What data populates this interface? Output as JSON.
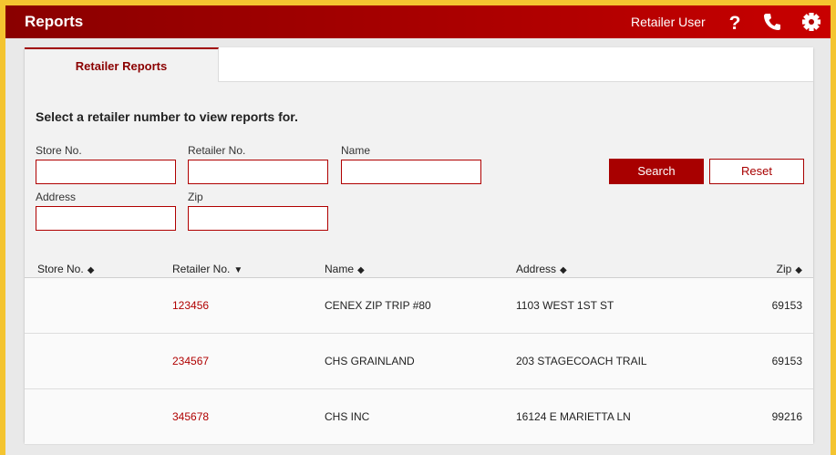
{
  "header": {
    "title": "Reports",
    "user_label": "Retailer User",
    "icons": [
      "help-icon",
      "phone-icon",
      "gear-icon"
    ],
    "color": "#a80000"
  },
  "tabs": [
    {
      "label": "Retailer Reports",
      "active": true
    }
  ],
  "instructions": "Select a retailer number to view reports for.",
  "form": {
    "store_no_label": "Store No.",
    "retailer_no_label": "Retailer No.",
    "name_label": "Name",
    "address_label": "Address",
    "zip_label": "Zip",
    "store_no_value": "",
    "retailer_no_value": "",
    "name_value": "",
    "address_value": "",
    "zip_value": "",
    "search_label": "Search",
    "reset_label": "Reset"
  },
  "table": {
    "columns": [
      "Store No.",
      "Retailer No.",
      "Name",
      "Address",
      "Zip"
    ],
    "sorted_column": "Retailer No.",
    "rows": [
      {
        "store_no": "",
        "retailer_no": "123456",
        "name": "CENEX ZIP TRIP #80",
        "address": "1103 WEST 1ST ST",
        "zip": "69153"
      },
      {
        "store_no": "",
        "retailer_no": "234567",
        "name": "CHS GRAINLAND",
        "address": "203 STAGECOACH TRAIL",
        "zip": "69153"
      },
      {
        "store_no": "",
        "retailer_no": "345678",
        "name": "CHS INC",
        "address": "16124 E MARIETTA LN",
        "zip": "99216"
      }
    ]
  }
}
